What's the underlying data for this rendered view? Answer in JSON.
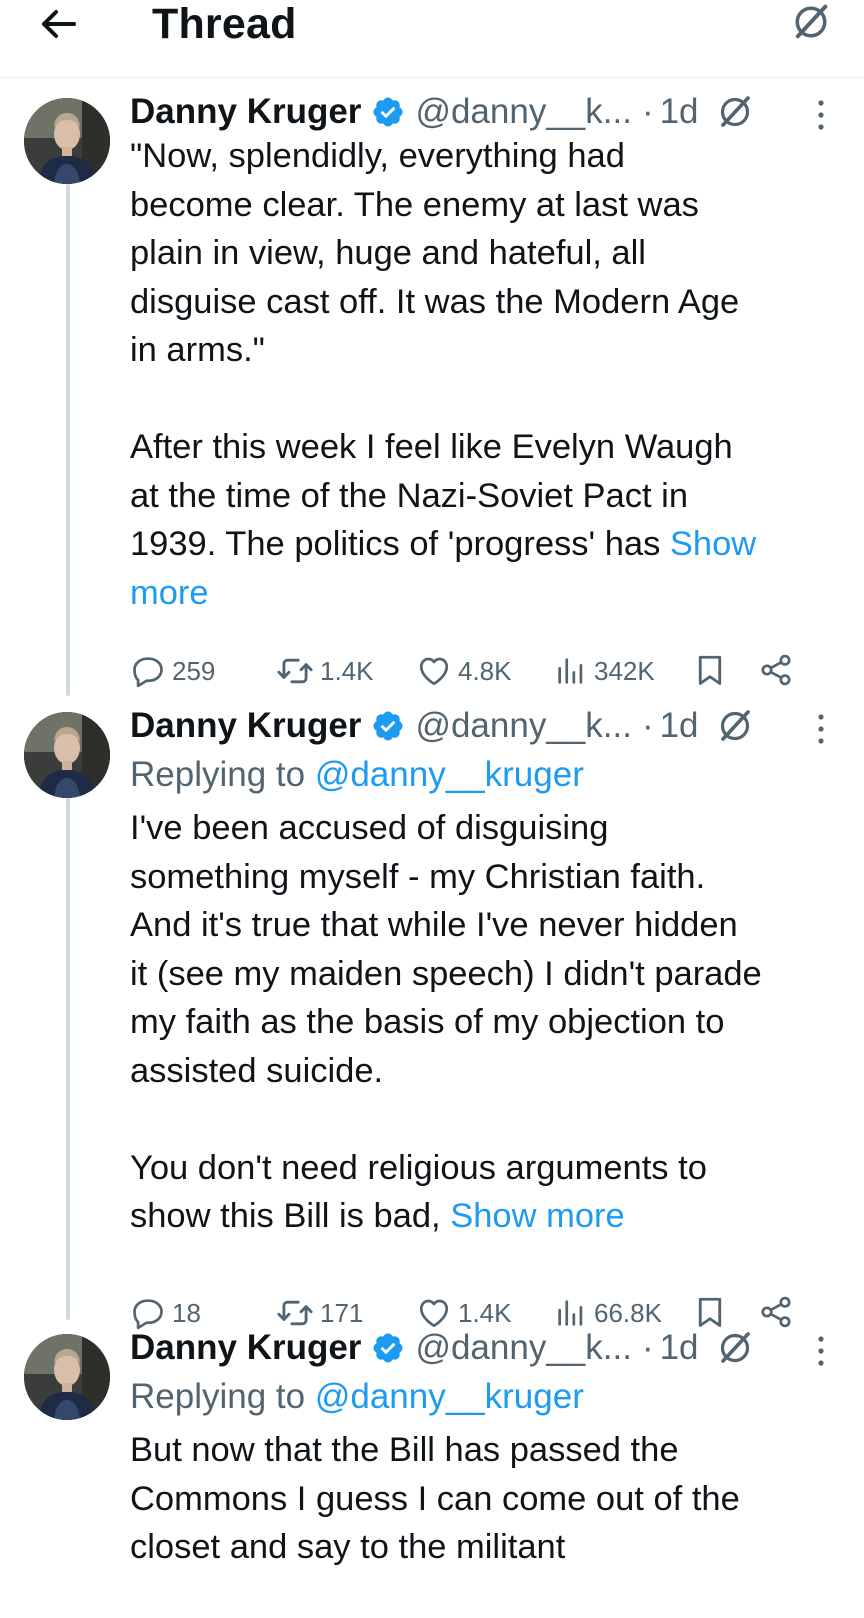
{
  "header": {
    "title": "Thread"
  },
  "icons": {
    "back": "arrow-left-icon",
    "grok": "grok-icon",
    "more": "more-vertical-icon",
    "reply": "reply-bubble-icon",
    "repost": "repost-icon",
    "like": "heart-icon",
    "views": "views-bar-chart-icon",
    "bookmark": "bookmark-icon",
    "share": "share-icon"
  },
  "colors": {
    "link": "#1d9bf0",
    "secondary_text": "#536471",
    "verified": "#1d9bf0",
    "thread_line": "#cfd9de"
  },
  "tweets": [
    {
      "name": "Danny Kruger",
      "handle": "@danny__k...",
      "dot": "·",
      "time": "1d",
      "text": "\"Now, splendidly, everything had\nbecome clear. The enemy at last was\nplain in view, huge and hateful, all\ndisguise cast off. It was the Modern Age\nin arms.\"\n\nAfter this week I feel like Evelyn Waugh\nat the time of the Nazi-Soviet Pact in\n1939. The politics of 'progress' has ",
      "show_more": "Show\nmore",
      "replies": "259",
      "reposts": "1.4K",
      "likes": "4.8K",
      "views": "342K"
    },
    {
      "name": "Danny Kruger",
      "handle": "@danny__k...",
      "dot": "·",
      "time": "1d",
      "replying_prefix": "Replying to ",
      "replying_to": "@danny__kruger",
      "text": "I've been accused of disguising\nsomething myself - my Christian faith.\nAnd it's true that while I've never hidden\nit (see my maiden speech) I didn't parade\nmy faith as the basis of my objection to\nassisted suicide.\n\nYou don't need religious arguments to\nshow this Bill is bad, ",
      "show_more": "Show more",
      "replies": "18",
      "reposts": "171",
      "likes": "1.4K",
      "views": "66.8K"
    },
    {
      "name": "Danny Kruger",
      "handle": "@danny__k...",
      "dot": "·",
      "time": "1d",
      "replying_prefix": "Replying to ",
      "replying_to": "@danny__kruger",
      "text": "But now that the Bill has passed the\nCommons I guess I can come out of the\ncloset and say to the militant"
    }
  ]
}
